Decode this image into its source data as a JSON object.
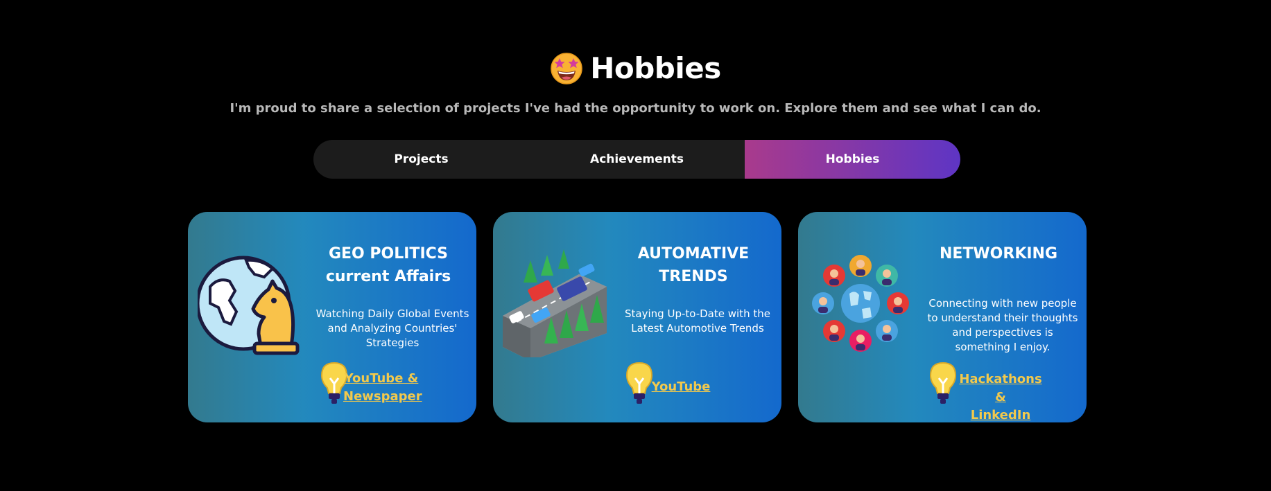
{
  "section": {
    "title": "Hobbies",
    "subtitle": "I'm proud to share a selection of projects I've had the opportunity to work on. Explore them and see what I can do."
  },
  "tabs": [
    {
      "label": "Projects",
      "active": false
    },
    {
      "label": "Achievements",
      "active": false
    },
    {
      "label": "Hobbies",
      "active": true
    }
  ],
  "cards": [
    {
      "title_line1": "GEO POLITICS",
      "title_line2": "current Affairs",
      "description": "Watching Daily Global Events and Analyzing Countries' Strategies",
      "link_line1": "YouTube &",
      "link_line2": "Newspaper",
      "icon": "globe-chess-knight-icon"
    },
    {
      "title_line1": "AUTOMATIVE",
      "title_line2": "TRENDS",
      "description": "Staying Up-to-Date with the Latest Automotive Trends",
      "link_line1": "YouTube",
      "icon": "highway-cars-icon"
    },
    {
      "title_line1": "NETWORKING",
      "description": "Connecting with new people to understand their thoughts and perspectives is something I enjoy.",
      "link_line1": "Hackathons &",
      "link_line2": "LinkedIn",
      "icon": "people-network-globe-icon"
    }
  ],
  "colors": {
    "background": "#000000",
    "tab_bar": "#1c1c1c",
    "tab_active_start": "#a93a8c",
    "tab_active_end": "#5e35c4",
    "card_start": "#337a8e",
    "card_end": "#1469cd",
    "link": "#f2c94c"
  }
}
